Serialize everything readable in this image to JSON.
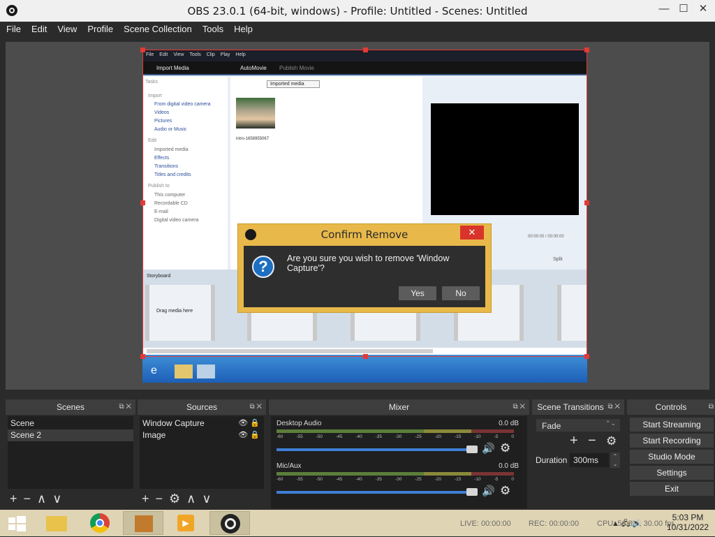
{
  "window": {
    "title": "OBS 23.0.1 (64-bit, windows) - Profile: Untitled - Scenes: Untitled"
  },
  "menu": [
    "File",
    "Edit",
    "View",
    "Profile",
    "Scene Collection",
    "Tools",
    "Help"
  ],
  "captured_app": {
    "menu": [
      "File",
      "Edit",
      "View",
      "Tools",
      "Clip",
      "Play",
      "Help"
    ],
    "toolbar": {
      "import_media": "Import Media",
      "automovie": "AutoMovie",
      "publish_movie": "Publish Movie"
    },
    "tasks": {
      "title": "Tasks",
      "import_header": "Import",
      "import_items": [
        "From digital video camera",
        "Videos",
        "Pictures",
        "Audio or Music"
      ],
      "edit_header": "Edit",
      "edit_items": [
        "Imported media",
        "Effects",
        "Transitions",
        "Titles and credits"
      ],
      "publish_header": "Publish to",
      "publish_items": [
        "This computer",
        "Recordable CD",
        "E-mail",
        "Digital video camera"
      ]
    },
    "collection_dropdown": "Imported media",
    "clip_name": "intro-1658955067",
    "player_time": "00:00:00 / 00:00:00",
    "split_label": "Split",
    "storyboard_label": "Storyboard",
    "drag_media": "Drag media here"
  },
  "dialog": {
    "title": "Confirm Remove",
    "message": "Are you sure you wish to remove 'Window Capture'?",
    "yes": "Yes",
    "no": "No"
  },
  "docks": {
    "scenes": {
      "title": "Scenes",
      "items": [
        "Scene",
        "Scene 2"
      ],
      "selected": "Scene 2"
    },
    "sources": {
      "title": "Sources",
      "items": [
        "Window Capture",
        "Image"
      ]
    },
    "mixer": {
      "title": "Mixer",
      "channels": [
        {
          "name": "Desktop Audio",
          "db": "0.0 dB"
        },
        {
          "name": "Mic/Aux",
          "db": "0.0 dB"
        }
      ],
      "scale": [
        "-60",
        "-55",
        "-50",
        "-45",
        "-40",
        "-35",
        "-30",
        "-25",
        "-20",
        "-15",
        "-10",
        "-5",
        "0"
      ]
    },
    "transitions": {
      "title": "Scene Transitions",
      "type": "Fade",
      "duration_label": "Duration",
      "duration": "300ms"
    },
    "controls": {
      "title": "Controls",
      "buttons": [
        "Start Streaming",
        "Start Recording",
        "Studio Mode",
        "Settings",
        "Exit"
      ]
    }
  },
  "status": {
    "live": "LIVE: 00:00:00",
    "rec": "REC: 00:00:00",
    "cpu": "CPU: 56.8%, 30.00 fps"
  },
  "clock": {
    "time": "5:03 PM",
    "date": "10/31/2022"
  },
  "colors": {
    "selection": "#e53935",
    "dialog": "#e8b94a",
    "accent": "#3f7fd6"
  }
}
